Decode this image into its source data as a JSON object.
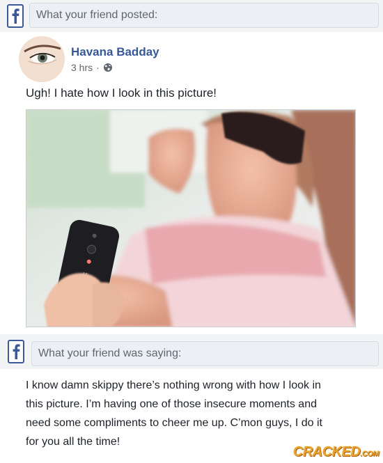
{
  "post_header": {
    "label": "What your friend posted:"
  },
  "author": {
    "name": "Havana Badday",
    "time": "3 hrs",
    "separator": "·",
    "privacy_icon": "globe-icon"
  },
  "post": {
    "text": "Ugh! I hate how I look in this picture!"
  },
  "comment_header": {
    "label": "What your friend was saying:"
  },
  "comment": {
    "text": "I know damn skippy there’s nothing wrong with how I look in this picture. I’m having one of those insecure moments and need some compliments to cheer me up. C’mon guys, I do it for you all the time!"
  },
  "watermark": {
    "brand": "CRACKED",
    "suffix": ".COM"
  },
  "colors": {
    "fb_blue": "#3b5998",
    "name_blue": "#365899",
    "bar_bg": "#eceff3",
    "watermark": "#e8a234"
  }
}
